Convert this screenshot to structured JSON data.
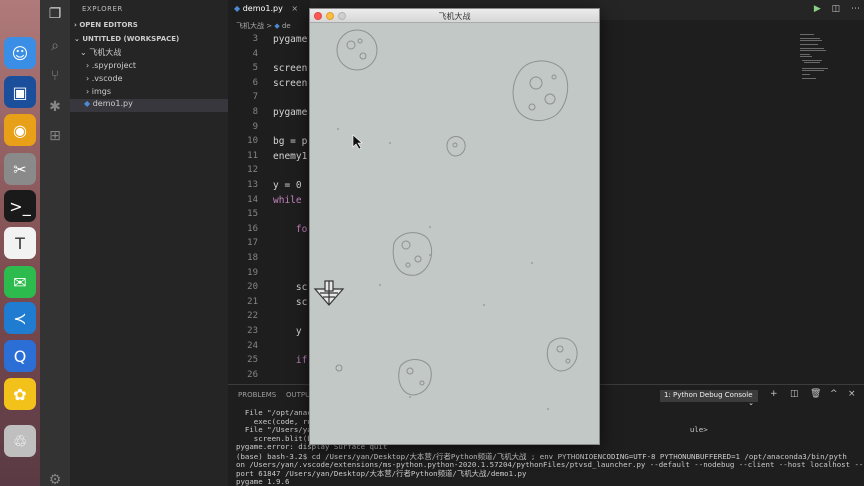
{
  "dock": {
    "apps": [
      {
        "name": "finder-icon",
        "glyph": "☺",
        "color": "#3a8ee6"
      },
      {
        "name": "virtualbox-icon",
        "glyph": "▣",
        "color": "#1b4f9c"
      },
      {
        "name": "chrome-icon",
        "glyph": "◉",
        "color": "#e8a019"
      },
      {
        "name": "preview-icon",
        "glyph": "✂",
        "color": "#8a8a8a"
      },
      {
        "name": "terminal-icon",
        "glyph": ">_",
        "color": "#1a1a1a"
      },
      {
        "name": "typora-icon",
        "glyph": "T",
        "color": "#f2f2f2"
      },
      {
        "name": "wechat-icon",
        "glyph": "✉",
        "color": "#2dbb4e"
      },
      {
        "name": "vscode-icon",
        "glyph": "≺",
        "color": "#1f7cd0"
      },
      {
        "name": "quicktime-icon",
        "glyph": "Q",
        "color": "#2b6fd6"
      },
      {
        "name": "python-icon",
        "glyph": "✿",
        "color": "#f3c21a"
      },
      {
        "name": "trash-icon",
        "glyph": "♲",
        "color": "#bfbfbf"
      }
    ]
  },
  "explorer": {
    "title": "EXPLORER",
    "open_editors": "OPEN EDITORS",
    "workspace": "UNTITLED (WORKSPACE)",
    "root_folder": "飞机大战",
    "items": [
      ".spyproject",
      ".vscode",
      "imgs",
      "demo1.py"
    ]
  },
  "editor": {
    "tab": "demo1.py",
    "breadcrumb_folder": "飞机大战",
    "breadcrumb_sep": ">",
    "breadcrumb_file": "de",
    "lines": [
      {
        "n": "3",
        "text": "pygame"
      },
      {
        "n": "4",
        "text": ""
      },
      {
        "n": "5",
        "text": "screen"
      },
      {
        "n": "6",
        "text": "screen"
      },
      {
        "n": "7",
        "text": ""
      },
      {
        "n": "8",
        "text": "pygame"
      },
      {
        "n": "9",
        "text": ""
      },
      {
        "n": "10",
        "text": "bg = p"
      },
      {
        "n": "11",
        "text": "enemy1"
      },
      {
        "n": "12",
        "text": ""
      },
      {
        "n": "13",
        "text": "y = 0"
      },
      {
        "n": "14",
        "text": "while"
      },
      {
        "n": "15",
        "text": ""
      },
      {
        "n": "16",
        "text": "    fo"
      },
      {
        "n": "17",
        "text": ""
      },
      {
        "n": "18",
        "text": ""
      },
      {
        "n": "19",
        "text": ""
      },
      {
        "n": "20",
        "text": "    sc"
      },
      {
        "n": "21",
        "text": "    sc"
      },
      {
        "n": "22",
        "text": ""
      },
      {
        "n": "23",
        "text": "    y"
      },
      {
        "n": "24",
        "text": ""
      },
      {
        "n": "25",
        "text": "    if"
      },
      {
        "n": "26",
        "text": ""
      },
      {
        "n": "27",
        "text": ""
      }
    ]
  },
  "panel": {
    "tab_problems": "PROBLEMS",
    "tab_output": "OUTPU",
    "debug_console": "1: Python Debug Console",
    "terminal_lines": [
      "  File \"/opt/anac",
      "    exec(code, ru",
      "  File \"/Users/ya                                                                                     ule>",
      "    screen.blit(b",
      "pygame.error: display Surface quit",
      "(base) bash-3.2$ cd /Users/yan/Desktop/大本营/行者Python频道/飞机大战 ; env PYTHONIOENCODING=UTF-8 PYTHONUNBUFFERED=1 /opt/anaconda3/bin/pyth",
      "on /Users/yan/.vscode/extensions/ms-python.python-2020.1.57204/pythonFiles/ptvsd_launcher.py --default --nodebug --client --host localhost --",
      "port 61847 /Users/yan/Desktop/大本营/行者Python频道/飞机大战/demo1.py",
      "pygame 1.9.6"
    ]
  },
  "game_window": {
    "title": "飞机大战",
    "bg_color": "#c2c8c5"
  }
}
